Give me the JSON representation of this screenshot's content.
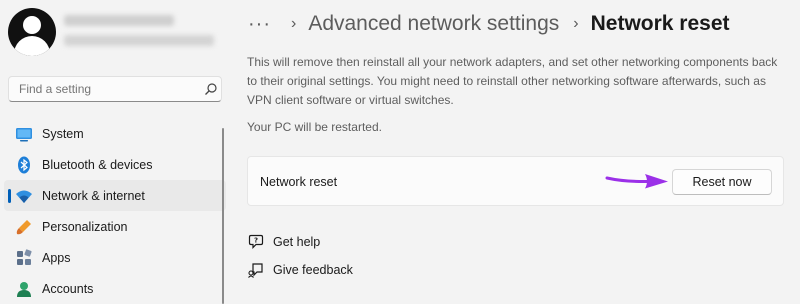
{
  "sidebar": {
    "search": {
      "placeholder": "Find a setting"
    },
    "items": [
      {
        "label": "System",
        "icon": "system-icon",
        "selected": false
      },
      {
        "label": "Bluetooth & devices",
        "icon": "bluetooth-icon",
        "selected": false
      },
      {
        "label": "Network & internet",
        "icon": "wifi-icon",
        "selected": true
      },
      {
        "label": "Personalization",
        "icon": "personalization-icon",
        "selected": false
      },
      {
        "label": "Apps",
        "icon": "apps-icon",
        "selected": false
      },
      {
        "label": "Accounts",
        "icon": "accounts-icon",
        "selected": false
      }
    ]
  },
  "header": {
    "more": "···",
    "separator": "›",
    "parent": "Advanced network settings",
    "current": "Network reset"
  },
  "main": {
    "description": "This will remove then reinstall all your network adapters, and set other networking components back to their original settings. You might need to reinstall other networking software afterwards, such as VPN client software or virtual switches.",
    "restart_note": "Your PC will be restarted.",
    "card": {
      "label": "Network reset",
      "button_label": "Reset now"
    },
    "links": {
      "help": "Get help",
      "feedback": "Give feedback"
    }
  },
  "colors": {
    "accent": "#005fb8",
    "arrow": "#9b30e8",
    "background": "#f3f3f3"
  }
}
